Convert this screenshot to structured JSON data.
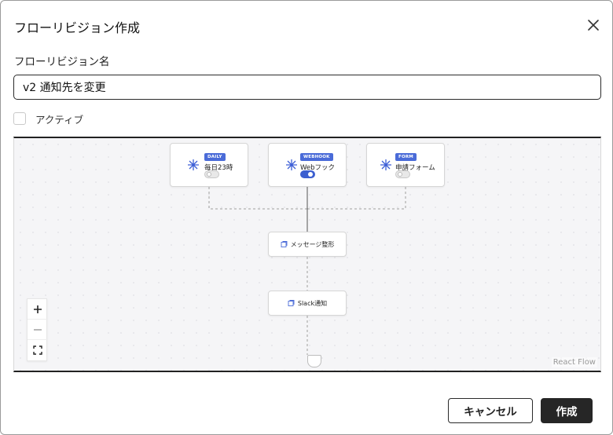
{
  "dialog": {
    "title": "フローリビジョン作成",
    "close_icon": "close-icon"
  },
  "form": {
    "name_label": "フローリビジョン名",
    "name_value": "v2 通知先を変更",
    "active_label": "アクティブ",
    "active_checked": false
  },
  "flow": {
    "triggers": [
      {
        "badge": "DAILY",
        "label": "毎日23時",
        "enabled": false
      },
      {
        "badge": "WEBHOOK",
        "label": "Webフック",
        "enabled": true
      },
      {
        "badge": "FORM",
        "label": "申請フォーム",
        "enabled": false
      }
    ],
    "actions": [
      {
        "label": "メッセージ整形"
      },
      {
        "label": "Slack通知"
      }
    ],
    "controls": [
      "zoom-in-icon",
      "zoom-out-icon",
      "fit-view-icon"
    ],
    "attribution": "React Flow",
    "colors": {
      "badge": "#4a6bd8",
      "toggle_on": "#3c5fd0",
      "star": "#3d5fd6"
    }
  },
  "footer": {
    "cancel_label": "キャンセル",
    "create_label": "作成"
  }
}
